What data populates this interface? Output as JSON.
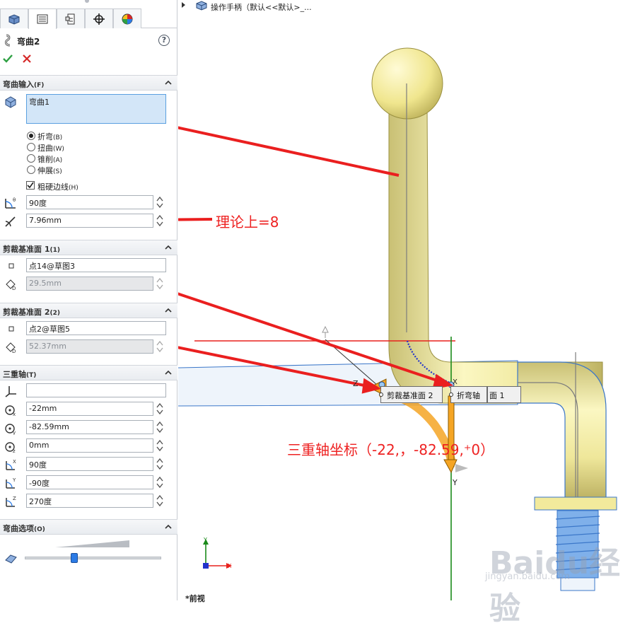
{
  "viewport": {
    "title": "操作手柄（默认<<默认>_...",
    "bottom_label": "*前视",
    "watermark": "Baidu经验",
    "watermark_sub": "jingyan.baidu.com",
    "callouts": {
      "trim_plane_2": "剪裁基准面 2",
      "bend_axis": "折弯轴",
      "trim_plane_1_tail": "面 1"
    },
    "annotations": {
      "theory": "理论上=8",
      "triad_coords": "三重轴坐标（-22,，-82.59,⁺0）"
    },
    "triad_labels": {
      "x": "X",
      "y": "Y",
      "z": "Z"
    },
    "axis_indicator": {
      "x": "X",
      "y": "Y"
    }
  },
  "panel": {
    "tabs": [
      "feature-manager",
      "property-manager",
      "configuration-manager",
      "dimxpert-manager",
      "display-manager"
    ],
    "feature": {
      "title": "弯曲2",
      "help": "?"
    },
    "sections": {
      "bend_input": {
        "title": "弯曲输入",
        "shortcut": "(F)",
        "body": "弯曲1",
        "options": [
          {
            "label": "折弯",
            "shortcut": "(B)",
            "selected": true
          },
          {
            "label": "扭曲",
            "shortcut": "(W)",
            "selected": false
          },
          {
            "label": "锥削",
            "shortcut": "(A)",
            "selected": false
          },
          {
            "label": "伸展",
            "shortcut": "(S)",
            "selected": false
          }
        ],
        "hard_edges": {
          "label": "粗硬边线",
          "shortcut": "(H)",
          "checked": true
        },
        "angle": "90度",
        "radius": "7.96mm"
      },
      "trim_plane_1": {
        "title": "剪裁基准面 1",
        "shortcut": "(1)",
        "reference": "点14@草图3",
        "offset": "29.5mm"
      },
      "trim_plane_2": {
        "title": "剪裁基准面 2",
        "shortcut": "(2)",
        "reference": "点2@草图5",
        "offset": "52.37mm"
      },
      "triad": {
        "title": "三重轴",
        "shortcut": "(T)",
        "selection": "",
        "x": "-22mm",
        "y": "-82.59mm",
        "z": "0mm",
        "rot_x": "90度",
        "rot_y": "-90度",
        "rot_z": "270度"
      },
      "bend_options": {
        "title": "弯曲选项",
        "shortcut": "(O)",
        "accuracy": 0.35
      }
    }
  }
}
